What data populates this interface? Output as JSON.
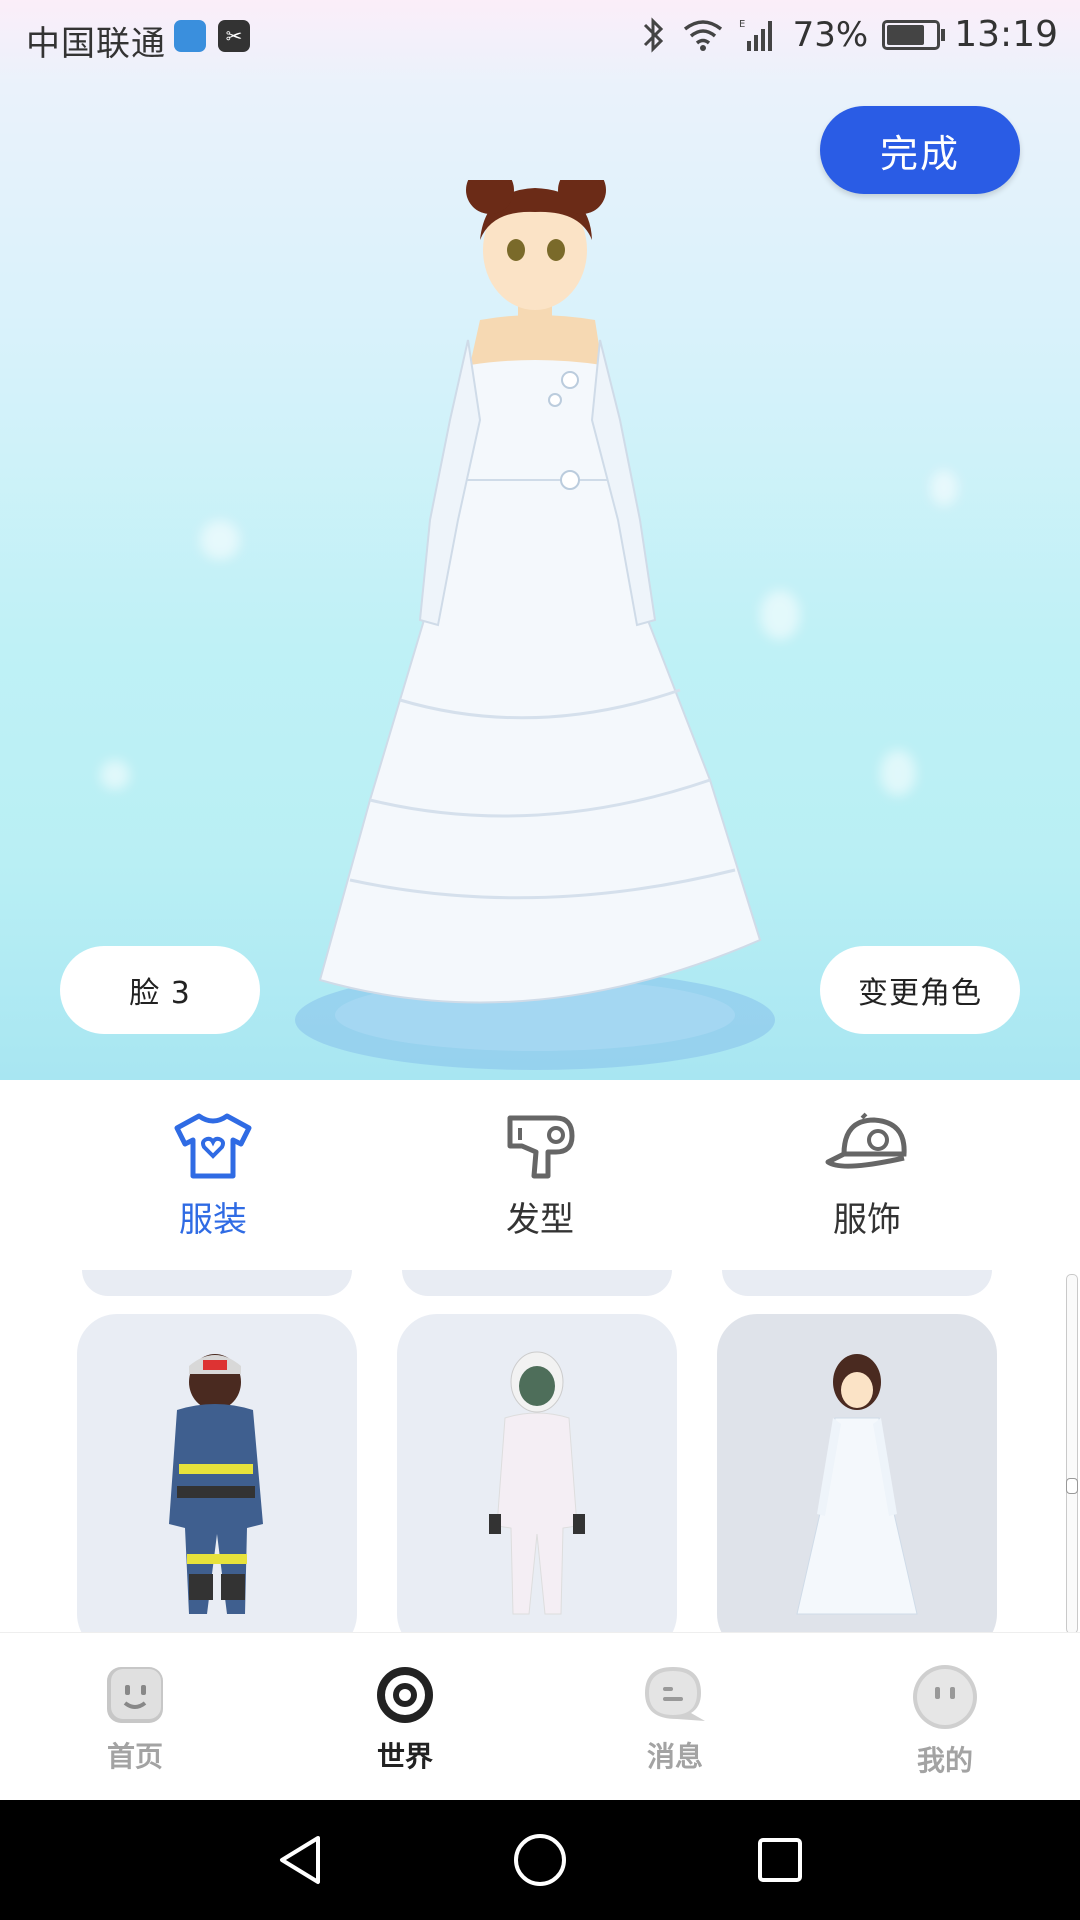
{
  "status_bar": {
    "carrier": "中国联通",
    "battery_percent": "73%",
    "time": "13:19"
  },
  "header": {
    "done_label": "完成"
  },
  "preview": {
    "face_label": "脸 3",
    "change_character_label": "变更角色"
  },
  "categories": [
    {
      "label": "服装",
      "icon": "tshirt-icon",
      "active": true
    },
    {
      "label": "发型",
      "icon": "hair-dryer-icon",
      "active": false
    },
    {
      "label": "服饰",
      "icon": "cap-icon",
      "active": false
    }
  ],
  "outfits": [
    {
      "name": "firefighter-outfit"
    },
    {
      "name": "astronaut-outfit"
    },
    {
      "name": "wedding-dress-outfit"
    }
  ],
  "bottom_nav": [
    {
      "label": "首页",
      "icon": "home-face-icon",
      "active": false
    },
    {
      "label": "世界",
      "icon": "world-ring-icon",
      "active": true
    },
    {
      "label": "消息",
      "icon": "message-bubble-icon",
      "active": false
    },
    {
      "label": "我的",
      "icon": "profile-face-icon",
      "active": false
    }
  ],
  "colors": {
    "accent": "#2a5ce5",
    "active_tab": "#2f6be4",
    "inactive_nav": "#a3a3a3"
  }
}
